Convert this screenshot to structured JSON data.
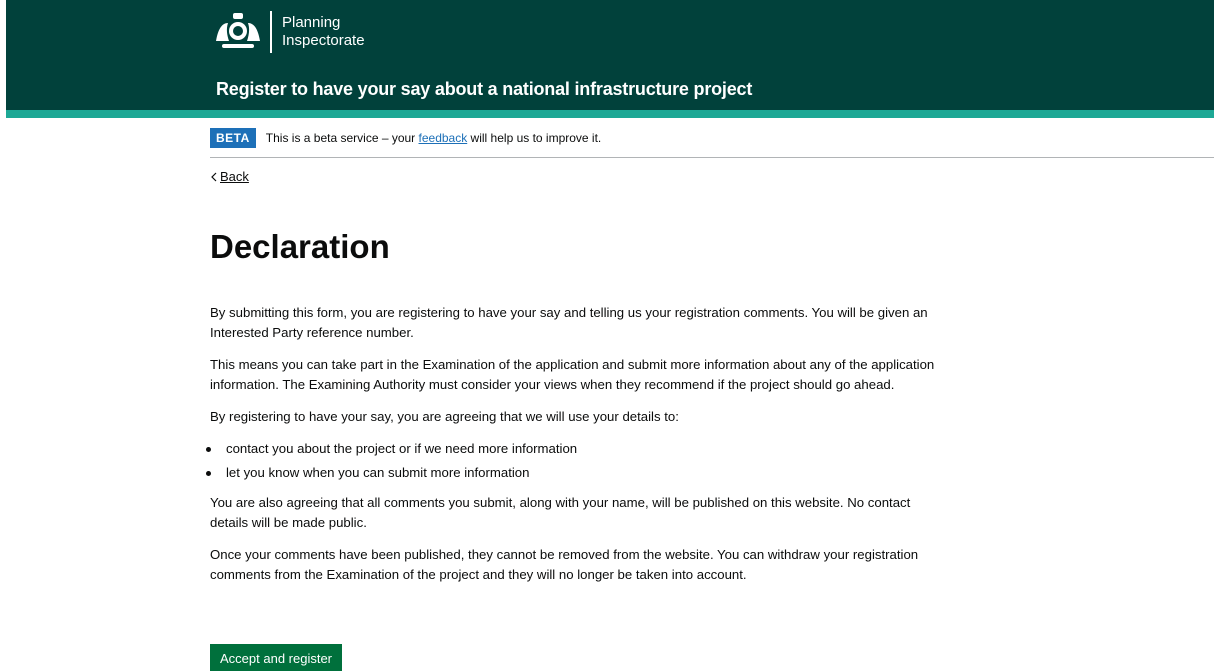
{
  "header": {
    "org_line1": "Planning",
    "org_line2": "Inspectorate",
    "service_name": "Register to have your say about a national infrastructure project",
    "colors": {
      "background": "#01413b",
      "accent": "#1da895"
    }
  },
  "beta_banner": {
    "tag": "BETA",
    "text_before": "This is a beta service – your ",
    "link_text": "feedback",
    "text_after": " will help us to improve it."
  },
  "back_link": {
    "label": "Back",
    "icon": "chevron-left-icon"
  },
  "page": {
    "title": "Declaration",
    "paragraphs": [
      "By submitting this form, you are registering to have your say and telling us your registration comments. You will be given an Interested Party reference number.",
      "This means you can take part in the Examination of the application and submit more information about any of the application information. The Examining Authority must consider your views when they recommend if the project should go ahead.",
      "By registering to have your say, you are agreeing that we will use your details to:"
    ],
    "bullets": [
      "contact you about the project or if we need more information",
      "let you know when you can submit more information"
    ],
    "paragraphs_after": [
      "You are also agreeing that all comments you submit, along with your name, will be published on this website. No contact details will be made public.",
      "Once your comments have been published, they cannot be removed from the website. You can withdraw your registration comments from the Examination of the project and they will no longer be taken into account."
    ]
  },
  "actions": {
    "accept_label": "Accept and register",
    "button_color": "#00703c"
  }
}
